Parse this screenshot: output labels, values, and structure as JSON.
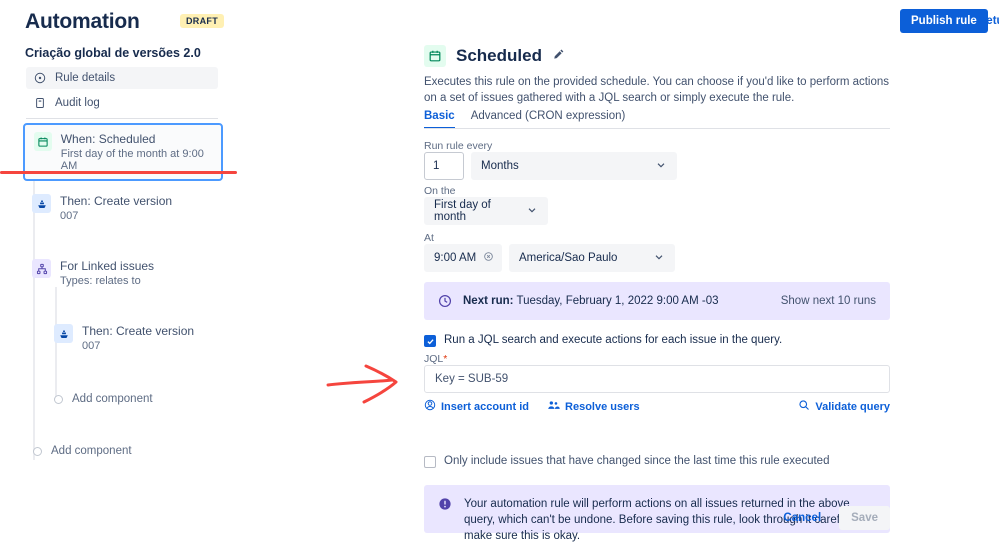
{
  "topbar": {
    "title": "Automation",
    "badge": "DRAFT",
    "publish_label": "Publish rule",
    "return_label": "Retu",
    "accent": "#0c5fd8",
    "badge_bg": "#fff0b3"
  },
  "sidebar": {
    "rule_name": "Criação global de versões 2.0",
    "nav": [
      {
        "label": "Rule details",
        "icon": "info-circle-icon"
      },
      {
        "label": "Audit log",
        "icon": "clipboard-icon"
      }
    ],
    "tree": {
      "when": {
        "title": "When: Scheduled",
        "subtitle": "First day of the month at 9:00 AM",
        "icon": "calendar-icon"
      },
      "then_create_version": {
        "title": "Then: Create version",
        "subtitle": "007",
        "icon": "version-ship-icon"
      },
      "for_linked_issues": {
        "title": "For Linked issues",
        "subtitle": "Types: relates to",
        "icon": "branch-icon"
      },
      "then_create_version_nested": {
        "title": "Then: Create version",
        "subtitle": "007",
        "icon": "version-ship-icon"
      },
      "add_component_nested": "Add component",
      "add_component_root": "Add component"
    }
  },
  "detail": {
    "title": "Scheduled",
    "description": "Executes this rule on the provided schedule. You can choose if you'd like to perform actions on a set of issues gathered with a JQL search or simply execute the rule.",
    "tabs": [
      {
        "label": "Basic",
        "active": true
      },
      {
        "label": "Advanced (CRON expression)",
        "active": false
      }
    ],
    "fields": {
      "run_rule_every_label": "Run rule every",
      "run_rule_every_value": "1",
      "interval_unit": "Months",
      "on_the_label": "On the",
      "on_the_value": "First day of month",
      "at_label": "At",
      "at_value": "9:00 AM",
      "timezone_value": "America/Sao Paulo"
    },
    "next_run": {
      "label": "Next run:",
      "value": "Tuesday, February 1, 2022 9:00 AM -03",
      "show_more": "Show next 10 runs"
    },
    "jql_search_checkbox": {
      "label": "Run a JQL search and execute actions for each issue in the query.",
      "checked": true
    },
    "jql": {
      "label": "JQL",
      "required_mark": "*",
      "value": "Key = SUB-59",
      "insert_account_id": "Insert account id",
      "resolve_users": "Resolve users",
      "validate_query": "Validate query"
    },
    "changed_only_checkbox": {
      "label": "Only include issues that have changed since the last time this rule executed",
      "checked": false
    },
    "warning": "Your automation rule will perform actions on all issues returned in the above query, which can't be undone. Before saving this rule, look through it carefully to make sure this is okay.",
    "cancel_label": "Cancel",
    "save_label": "Save"
  },
  "annotations": {
    "underline_color": "#f5453e",
    "arrow_color": "#f5453e"
  }
}
